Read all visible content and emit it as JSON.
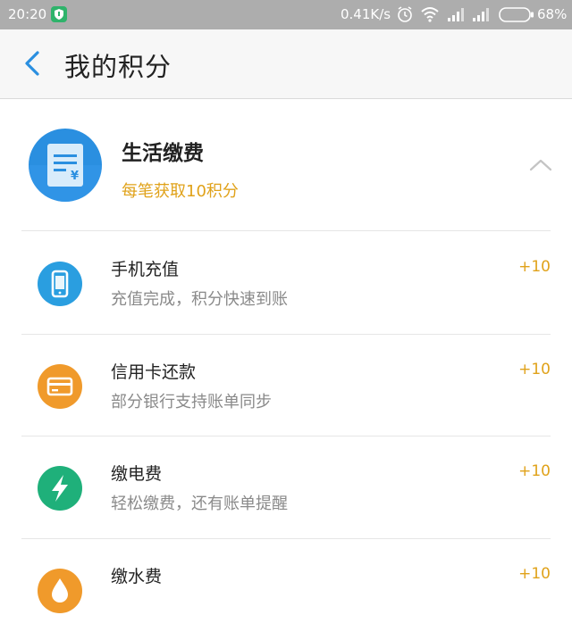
{
  "status_bar": {
    "time": "20:20",
    "net_speed": "0.41K/s",
    "battery": "68%"
  },
  "header": {
    "title": "我的积分"
  },
  "category": {
    "title": "生活缴费",
    "subtitle": "每笔获取10积分",
    "icon": "bill-icon",
    "accent": "#2a8fe0"
  },
  "items": [
    {
      "title": "手机充值",
      "desc": "充值完成，积分快速到账",
      "points": "+10",
      "icon": "phone-icon",
      "color": "#2a9ee0"
    },
    {
      "title": "信用卡还款",
      "desc": "部分银行支持账单同步",
      "points": "+10",
      "icon": "credit-card-icon",
      "color": "#f09a2b"
    },
    {
      "title": "缴电费",
      "desc": "轻松缴费，还有账单提醒",
      "points": "+10",
      "icon": "lightning-icon",
      "color": "#1fb07a"
    },
    {
      "title": "缴水费",
      "desc": "",
      "points": "+10",
      "icon": "water-icon",
      "color": "#f09a2b"
    }
  ],
  "colors": {
    "points": "#e0a21a",
    "back_arrow": "#2a8fe0",
    "status_bar": "#adadad"
  }
}
